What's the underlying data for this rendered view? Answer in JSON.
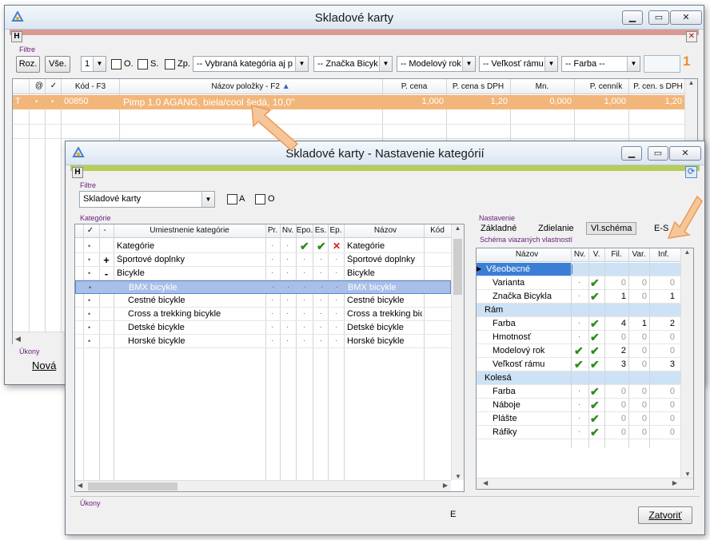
{
  "main_window": {
    "title": "Skladové karty",
    "h_label": "H",
    "filter_label": "Filtre",
    "roz_label": "Roz.",
    "vse_label": "Vše.",
    "count_value": "1",
    "chk_o_label": "O.",
    "chk_s_label": "S.",
    "chk_zp_label": "Zp.",
    "category_filter": "-- Vybraná kategória aj p",
    "brand_filter": "-- Značka Bicyk",
    "model_filter": "-- Modelový rok",
    "size_filter": "-- Veľkosť rámu",
    "color_filter": "-- Farba --",
    "badge_number": "1",
    "columns": [
      "Kód - F3",
      "Názov položky - F2",
      "P. cena",
      "P. cena s DPH",
      "Mn.",
      "P. cenník",
      "P. cen. s DPH"
    ],
    "row": {
      "type": "T",
      "code": "00850",
      "name": "Pimp 1.0 AGANG, biela/cool šedá, 10,0\"",
      "price": "1,000",
      "price_vat": "1,20",
      "qty": "0,000",
      "list_price": "1,000",
      "list_price_vat": "1,20"
    },
    "ukony_label": "Úkony",
    "nova_label": "Nová"
  },
  "category_window": {
    "title": "Skladové karty - Nastavenie kategórií",
    "h_label": "H",
    "filter_label": "Filtre",
    "filter_value": "Skladové karty",
    "chk_a_label": "A",
    "chk_o_label": "O",
    "categories_label": "Kategórie",
    "cat_columns": [
      "-",
      "Umiestnenie kategórie",
      "Pr.",
      "Nv.",
      "Epo.",
      "Es.",
      "Ep.",
      "Názov",
      "Kód"
    ],
    "categories": [
      {
        "marker": "",
        "location": "Kategórie",
        "name": "Kategórie"
      },
      {
        "marker": "+",
        "location": "Športové doplnky",
        "name": "Športové doplnky"
      },
      {
        "marker": "-",
        "location": "Bicykle",
        "name": "Bicykle"
      },
      {
        "marker": "",
        "location": "BMX bicykle",
        "name": "BMX bicykle"
      },
      {
        "marker": "",
        "location": "Cestné bicykle",
        "name": "Cestné bicykle"
      },
      {
        "marker": "",
        "location": "Cross a trekking bicykle",
        "name": "Cross a trekking bicy"
      },
      {
        "marker": "",
        "location": "Detské bicykle",
        "name": "Detské bicykle"
      },
      {
        "marker": "",
        "location": "Horské bicykle",
        "name": "Horské bicykle"
      }
    ],
    "settings_label": "Nastavenie",
    "tabs": [
      "Základné",
      "Zdielanie",
      "Vl.schéma",
      "E-S"
    ],
    "schema_label": "Schéma viazaných vlastností",
    "schema_columns": [
      "Názov",
      "Nv.",
      "V.",
      "Fil.",
      "Var.",
      "Inf."
    ],
    "schema_rows": [
      {
        "group": true,
        "name": "Všeobecné"
      },
      {
        "name": "Varianta",
        "nv": false,
        "v": true,
        "fil": "0",
        "var": "0",
        "inf": "0"
      },
      {
        "name": "Značka Bicykla",
        "nv": false,
        "v": true,
        "fil": "1",
        "var": "0",
        "inf": "1"
      },
      {
        "group": true,
        "name": "Rám"
      },
      {
        "name": "Farba",
        "nv": false,
        "v": true,
        "fil": "4",
        "var": "1",
        "inf": "2"
      },
      {
        "name": "Hmotnosť",
        "nv": false,
        "v": true,
        "fil": "0",
        "var": "0",
        "inf": "0"
      },
      {
        "name": "Modelový rok",
        "nv": true,
        "v": true,
        "fil": "2",
        "var": "0",
        "inf": "0"
      },
      {
        "name": "Veľkosť rámu",
        "nv": true,
        "v": true,
        "fil": "3",
        "var": "0",
        "inf": "3"
      },
      {
        "group": true,
        "name": "Kolesá"
      },
      {
        "name": "Farba",
        "nv": false,
        "v": true,
        "fil": "0",
        "var": "0",
        "inf": "0"
      },
      {
        "name": "Náboje",
        "nv": false,
        "v": true,
        "fil": "0",
        "var": "0",
        "inf": "0"
      },
      {
        "name": "Plášte",
        "nv": false,
        "v": true,
        "fil": "0",
        "var": "0",
        "inf": "0"
      },
      {
        "name": "Ráfiky",
        "nv": false,
        "v": true,
        "fil": "0",
        "var": "0",
        "inf": "0"
      }
    ],
    "ukony_label": "Úkony",
    "status_e": "E",
    "close_label": "Zatvoriť"
  },
  "colors": {
    "selected_row": "#f2b67a",
    "bmx_selected": "#a9bfe8",
    "group_row": "#cde2f5",
    "accent_orange": "#f08c30",
    "main_hbar": "#d99a94",
    "cat_hbar": "#b8cc5a"
  }
}
